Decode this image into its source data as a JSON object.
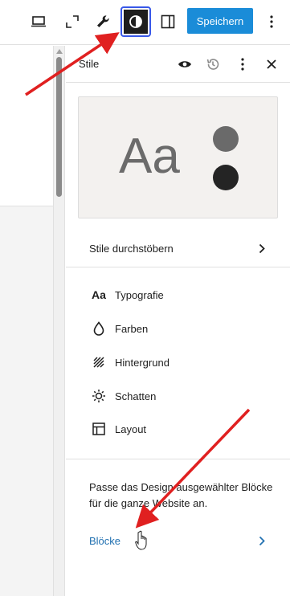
{
  "toolbar": {
    "icons": [
      "laptop-icon",
      "fullscreen-icon",
      "wrench-icon",
      "contrast-icon",
      "sidebar-icon"
    ],
    "save_label": "Speichern",
    "more_icon": "vertical-dots-icon",
    "accent_color": "#1a8cd8"
  },
  "sidebar": {
    "title": "Stile",
    "header_icons": [
      "eye-icon",
      "history-icon",
      "vertical-dots-icon",
      "close-icon"
    ],
    "preview": {
      "sample_text": "Aa",
      "swatches": [
        "#6a6a6a",
        "#242424"
      ]
    },
    "browse_label": "Stile durchstöbern",
    "items": [
      {
        "label": "Typografie",
        "icon": "typography-icon",
        "icon_text": "Aa"
      },
      {
        "label": "Farben",
        "icon": "droplet-icon"
      },
      {
        "label": "Hintergrund",
        "icon": "background-icon"
      },
      {
        "label": "Schatten",
        "icon": "sun-shadow-icon"
      },
      {
        "label": "Layout",
        "icon": "layout-icon"
      }
    ],
    "blocks_description": "Passe das Design ausgewählter Blöcke für die ganze Website an.",
    "blocks_label": "Blöcke",
    "link_color": "#2271b1"
  },
  "annotations": {
    "arrow_color": "#e02020"
  }
}
